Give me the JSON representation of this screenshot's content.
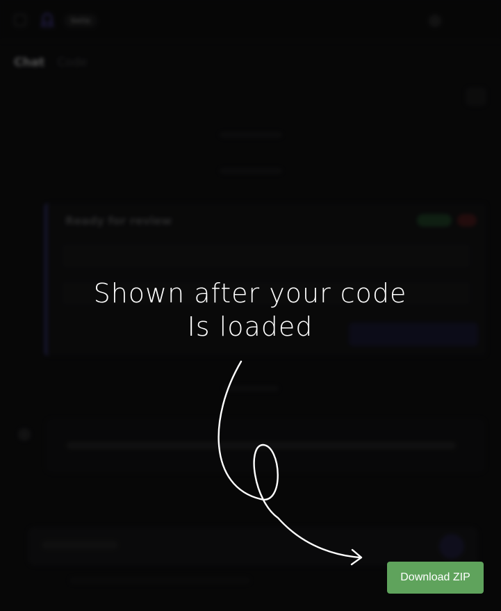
{
  "header": {
    "badge": "beta"
  },
  "tabs": [
    "Chat",
    "Code"
  ],
  "card": {
    "title": "Ready for review"
  },
  "overlay": {
    "line1": "Shown after your code",
    "line2": "Is loaded"
  },
  "cta": {
    "label": "Download ZIP",
    "color": "#5fa35c"
  },
  "icons": [
    "sidebar-toggle-icon",
    "octopus-logo-icon",
    "settings-icon",
    "curved-arrow-icon"
  ]
}
